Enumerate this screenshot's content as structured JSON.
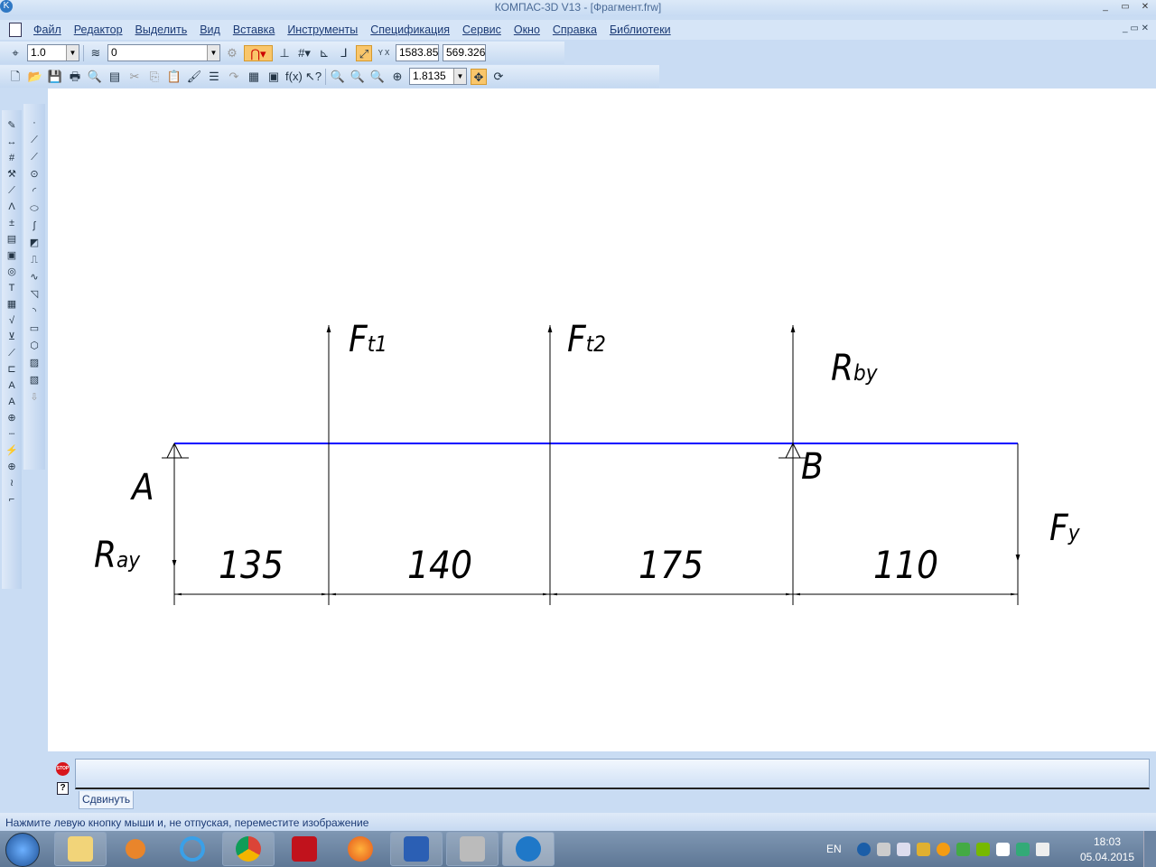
{
  "window": {
    "title": "КОМПАС-3D V13 - [Фрагмент.frw]"
  },
  "menu": [
    "Файл",
    "Редактор",
    "Выделить",
    "Вид",
    "Вставка",
    "Инструменты",
    "Спецификация",
    "Сервис",
    "Окно",
    "Справка",
    "Библиотеки"
  ],
  "toolbar": {
    "step": "1.0",
    "layer": "0",
    "coord_x": "1583.85",
    "coord_y": "569.326",
    "zoom": "1.8135",
    "coord_label": "Y X"
  },
  "drawing": {
    "beam_color": "#0000ff",
    "labels": {
      "Ft1_main": "F",
      "Ft1_sub": "t1",
      "Ft2_main": "F",
      "Ft2_sub": "t2",
      "Rby_main": "R",
      "Rby_sub": "by",
      "B": "B",
      "A": "A",
      "Ray_main": "R",
      "Ray_sub": "ay",
      "Fy_main": "F",
      "Fy_sub": "y"
    },
    "dimensions": [
      "135",
      "140",
      "175",
      "110"
    ]
  },
  "panel": {
    "stop_label": "STOP",
    "tab": "Сдвинуть"
  },
  "status": "Нажмите левую кнопку мыши и, не отпуская, переместите изображение",
  "tray": {
    "lang": "EN",
    "time": "18:03",
    "date": "05.04.2015"
  }
}
